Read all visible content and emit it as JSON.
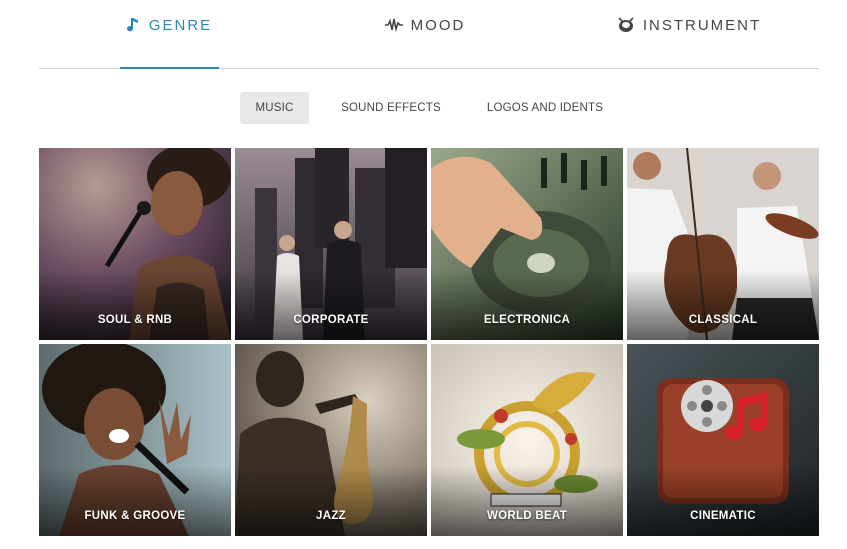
{
  "category_tabs": [
    {
      "label": "GENRE",
      "icon": "music-note-icon",
      "active": true
    },
    {
      "label": "MOOD",
      "icon": "waveform-icon",
      "active": false
    },
    {
      "label": "INSTRUMENT",
      "icon": "drum-icon",
      "active": false
    }
  ],
  "sub_tabs": [
    {
      "label": "MUSIC",
      "active": true
    },
    {
      "label": "SOUND EFFECTS",
      "active": false
    },
    {
      "label": "LOGOS AND IDENTS",
      "active": false
    }
  ],
  "genres": [
    {
      "label": "SOUL & RNB"
    },
    {
      "label": "CORPORATE"
    },
    {
      "label": "ELECTRONICA"
    },
    {
      "label": "CLASSICAL"
    },
    {
      "label": "FUNK & GROOVE"
    },
    {
      "label": "JAZZ"
    },
    {
      "label": "WORLD BEAT"
    },
    {
      "label": "CINEMATIC"
    }
  ],
  "colors": {
    "accent": "#2b85b8",
    "text": "#444444",
    "active_subtab_bg": "#e8e8e8"
  }
}
